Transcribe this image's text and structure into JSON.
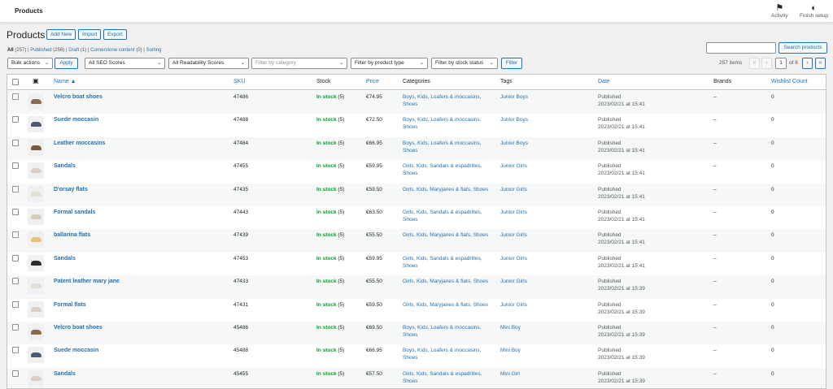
{
  "topbar": {
    "title": "Products",
    "activity": "Activity",
    "finish_setup": "Finish setup"
  },
  "page": {
    "heading": "Products",
    "add_new": "Add New",
    "import": "Import",
    "export": "Export"
  },
  "subsubsub": {
    "all": "All",
    "all_count": "(257)",
    "published": "Published",
    "published_count": "(256)",
    "draft": "Draft",
    "draft_count": "(1)",
    "cornerstone": "Cornerstone content",
    "cornerstone_count": "(0)",
    "sorting": "Sorting"
  },
  "search": {
    "button": "Search products"
  },
  "filters": {
    "bulk_actions": "Bulk actions",
    "apply": "Apply",
    "seo_scores": "All SEO Scores",
    "readability": "All Readability Scores",
    "category_placeholder": "Filter by category",
    "product_type": "Filter by product type",
    "stock_status": "Filter by stock status",
    "filter_button": "Filter"
  },
  "pagination": {
    "items": "257 items",
    "first": "«",
    "prev": "‹",
    "current": "1",
    "of": "of 6",
    "next": "›",
    "last": "»"
  },
  "columns": {
    "name": "Name ▲",
    "sku": "SKU",
    "stock": "Stock",
    "price": "Price",
    "categories": "Categories",
    "tags": "Tags",
    "date": "Date",
    "brands": "Brands",
    "wishlist": "Wishlist Count"
  },
  "thumb_colors": [
    "#8a6a4f",
    "#4a5a70",
    "#7a5a3f",
    "#d8d0c4",
    "#e6dfd3",
    "#d6ccbd",
    "#e8c07a",
    "#2a2a2a",
    "#e4ddd6",
    "#d9cfc2",
    "#8a6a4f",
    "#4a5a70",
    "#d8d0c4"
  ],
  "products": [
    {
      "name": "Velcro boat shoes",
      "sku": "47486",
      "stock": "In stock",
      "qty": "(5)",
      "price": "€74.95",
      "cat1": "Boys, Kids, Loafers & moccasins,",
      "cat2": "Shoes",
      "tag": "Junior Boys",
      "status": "Published",
      "date": "2023/02/21 at 15:41",
      "brand": "–",
      "wish": "0"
    },
    {
      "name": "Suede moccasin",
      "sku": "47488",
      "stock": "In stock",
      "qty": "(5)",
      "price": "€72.50",
      "cat1": "Boys, Kids, Loafers & moccasins,",
      "cat2": "Shoes",
      "tag": "Junior Boys",
      "status": "Published",
      "date": "2023/02/21 at 15:41",
      "brand": "–",
      "wish": "0"
    },
    {
      "name": "Leather moccasins",
      "sku": "47484",
      "stock": "In stock",
      "qty": "(5)",
      "price": "€66.95",
      "cat1": "Boys, Kids, Loafers & moccasins,",
      "cat2": "Shoes",
      "tag": "Junior Boys",
      "status": "Published",
      "date": "2023/02/21 at 15:41",
      "brand": "–",
      "wish": "0"
    },
    {
      "name": "Sandals",
      "sku": "47455",
      "stock": "In stock",
      "qty": "(5)",
      "price": "€59.95",
      "cat1": "Girls, Kids, Sandals & espadrilles,",
      "cat2": "Shoes",
      "tag": "Junior Girls",
      "status": "Published",
      "date": "2023/02/21 at 15:41",
      "brand": "–",
      "wish": "0"
    },
    {
      "name": "D'orsay flats",
      "sku": "47435",
      "stock": "In stock",
      "qty": "(5)",
      "price": "€59.50",
      "cat1": "Girls, Kids, Maryjanes & flats, Shoes",
      "cat2": "",
      "tag": "Junior Girls",
      "status": "Published",
      "date": "2023/02/21 at 15:41",
      "brand": "–",
      "wish": "0"
    },
    {
      "name": "Formal sandals",
      "sku": "47443",
      "stock": "In stock",
      "qty": "(5)",
      "price": "€63.50",
      "cat1": "Girls, Kids, Sandals & espadrilles,",
      "cat2": "Shoes",
      "tag": "Junior Girls",
      "status": "Published",
      "date": "2023/02/21 at 15:41",
      "brand": "–",
      "wish": "0"
    },
    {
      "name": "ballarina flats",
      "sku": "47439",
      "stock": "In stock",
      "qty": "(5)",
      "price": "€55.50",
      "cat1": "Girls, Kids, Maryjanes & flats, Shoes",
      "cat2": "",
      "tag": "Junior Girls",
      "status": "Published",
      "date": "2023/02/21 at 15:41",
      "brand": "–",
      "wish": "0"
    },
    {
      "name": "Sandals",
      "sku": "47453",
      "stock": "In stock",
      "qty": "(5)",
      "price": "€59.95",
      "cat1": "Girls, Kids, Sandals & espadrilles,",
      "cat2": "Shoes",
      "tag": "Junior Girls",
      "status": "Published",
      "date": "2023/02/21 at 15:41",
      "brand": "–",
      "wish": "0"
    },
    {
      "name": "Patent leather mary jane",
      "sku": "47433",
      "stock": "In stock",
      "qty": "(5)",
      "price": "€55.50",
      "cat1": "Girls, Kids, Maryjanes & flats, Shoes",
      "cat2": "",
      "tag": "Junior Girls",
      "status": "Published",
      "date": "2023/02/21 at 15:39",
      "brand": "–",
      "wish": "0"
    },
    {
      "name": "Formal flats",
      "sku": "47431",
      "stock": "In stock",
      "qty": "(5)",
      "price": "€59.50",
      "cat1": "Girls, Kids, Maryjanes & flats, Shoes",
      "cat2": "",
      "tag": "Junior Girls",
      "status": "Published",
      "date": "2023/02/21 at 15:39",
      "brand": "–",
      "wish": "0"
    },
    {
      "name": "Velcro boat shoes",
      "sku": "45486",
      "stock": "In stock",
      "qty": "(5)",
      "price": "€69.50",
      "cat1": "Boys, Kids, Loafers & moccasins,",
      "cat2": "Shoes",
      "tag": "Mini Boy",
      "status": "Published",
      "date": "2023/02/21 at 15:39",
      "brand": "–",
      "wish": "0"
    },
    {
      "name": "Suede moccasin",
      "sku": "45488",
      "stock": "In stock",
      "qty": "(5)",
      "price": "€66.95",
      "cat1": "Boys, Kids, Loafers & moccasins,",
      "cat2": "Shoes",
      "tag": "Mini Boy",
      "status": "Published",
      "date": "2023/02/21 at 15:39",
      "brand": "–",
      "wish": "0"
    },
    {
      "name": "Sandals",
      "sku": "45455",
      "stock": "In stock",
      "qty": "(5)",
      "price": "€57.50",
      "cat1": "Girls, Kids, Sandals & espadrilles,",
      "cat2": "Shoes",
      "tag": "Mini Girl",
      "status": "Published",
      "date": "2023/02/21 at 15:39",
      "brand": "–",
      "wish": "0"
    }
  ]
}
